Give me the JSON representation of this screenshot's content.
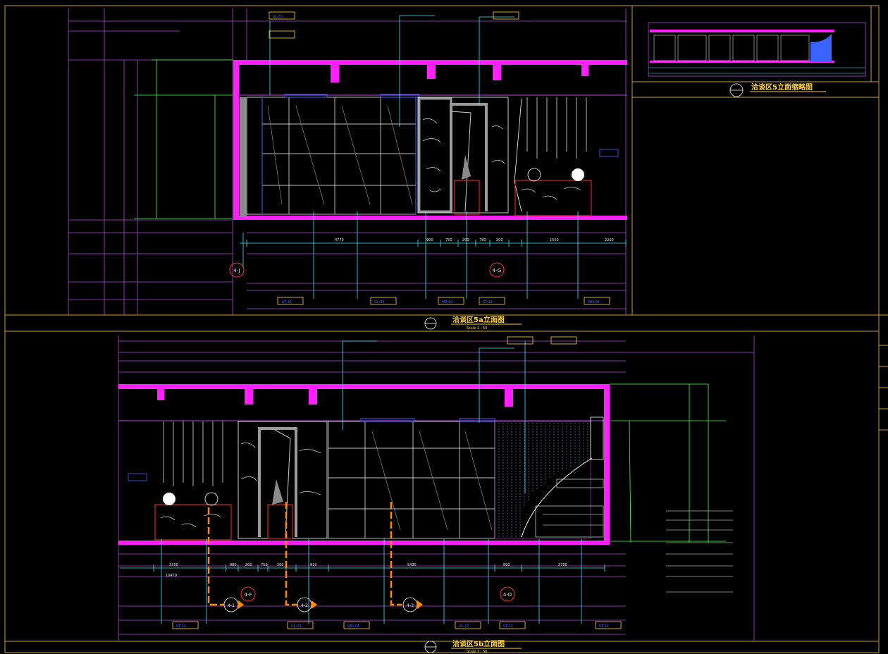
{
  "views": {
    "view_a": {
      "title": "洽谈区5a立面图",
      "scale": "Scale 1 : 50",
      "section_marks": [
        "4-J",
        "4-G"
      ],
      "tags": [
        "ST-12",
        "GL-02",
        "MR-01",
        "ST-12",
        "GL-01",
        "WD-04"
      ],
      "dims": [
        "4770",
        "900",
        "750",
        "200",
        "780",
        "200",
        "1550",
        "2250"
      ]
    },
    "view_b": {
      "title": "洽谈区5b立面图",
      "scale": "Scale 1 : 50",
      "section_marks": [
        "4-F",
        "4-D"
      ],
      "callouts": [
        "4-1",
        "4-2",
        "4-3"
      ],
      "tags": [
        "ST-12",
        "GL-02",
        "WD-04",
        "GL-02",
        "ST-12",
        "ST-12"
      ],
      "dims": [
        "2250",
        "980",
        "200",
        "750",
        "200",
        "910",
        "5430",
        "800",
        "2750",
        "10470"
      ]
    },
    "key_plan": {
      "title": "洽谈区5立面缩略图"
    }
  },
  "colors": {
    "background": "#000000",
    "frame": "#c8a238",
    "structure": "#ff1fff",
    "leader": "#39e6ff",
    "title": "#ffd23c",
    "detail": "#ffffff",
    "callout_path": "#ff8a00"
  }
}
